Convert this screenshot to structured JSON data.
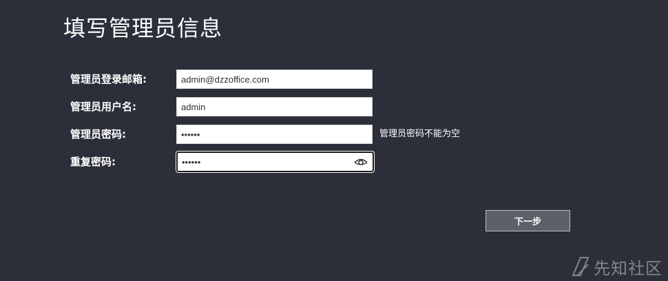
{
  "page": {
    "title": "填写管理员信息"
  },
  "form": {
    "email": {
      "label": "管理员登录邮箱:",
      "value": "admin@dzzoffice.com"
    },
    "username": {
      "label": "管理员用户名:",
      "value": "admin"
    },
    "password": {
      "label": "管理员密码:",
      "value": "••••••",
      "error": "管理员密码不能为空"
    },
    "confirm_password": {
      "label": "重复密码:",
      "value": "••••••",
      "icon": "eye-icon"
    }
  },
  "actions": {
    "next_label": "下一步"
  },
  "watermark": {
    "text": "先知社区"
  },
  "colors": {
    "background": "#2c2f3a",
    "button": "#5d6069",
    "input_bg": "#ffffff"
  }
}
